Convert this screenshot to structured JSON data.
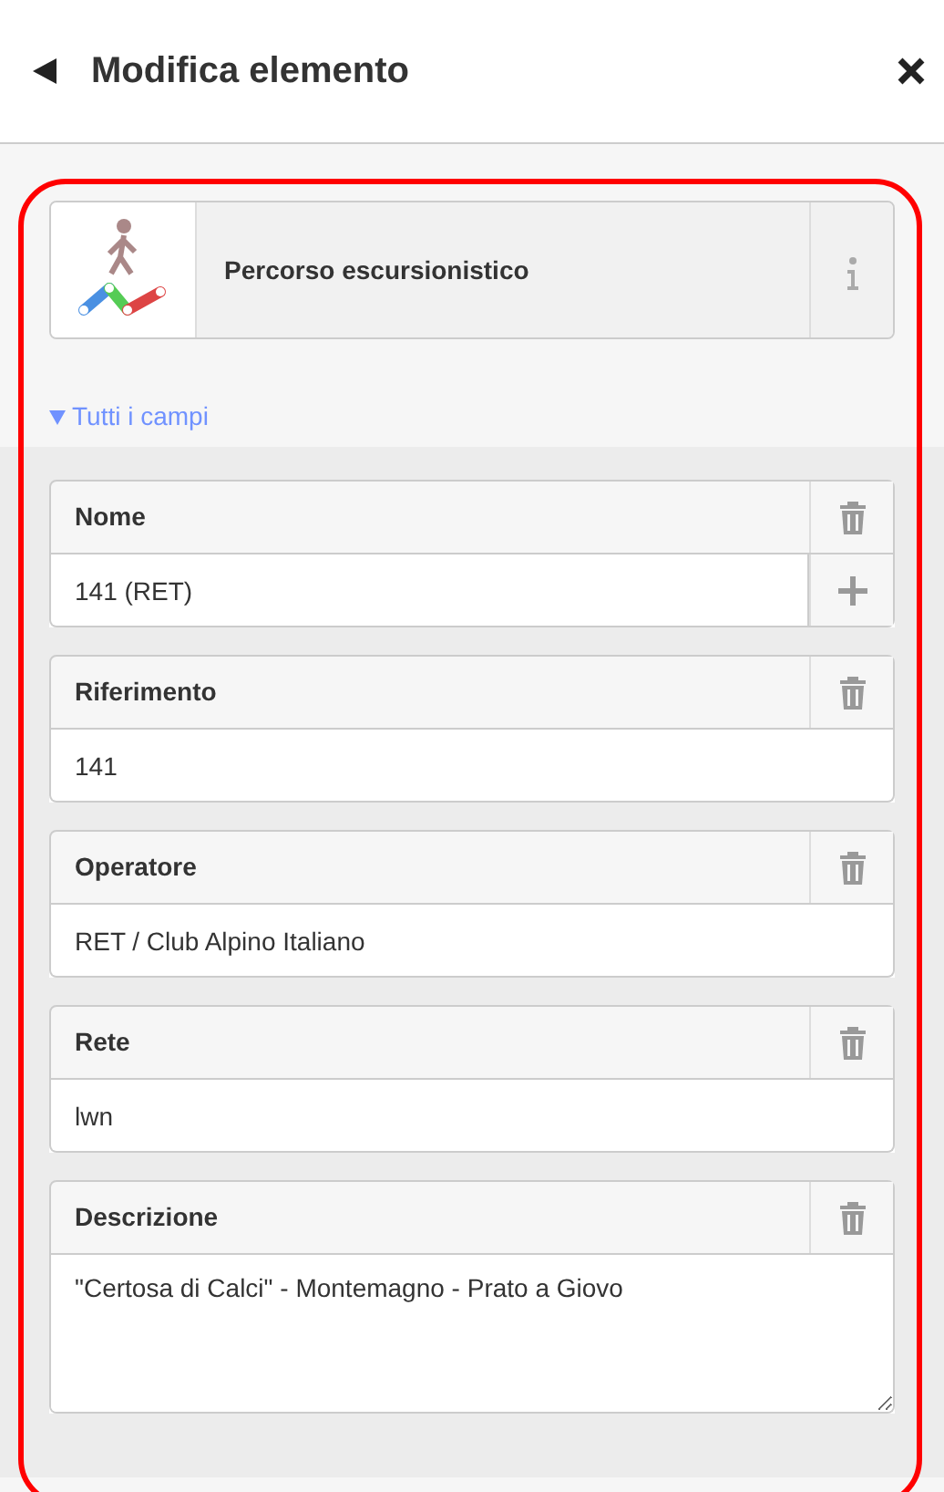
{
  "header": {
    "title": "Modifica elemento"
  },
  "preset": {
    "name": "Percorso escursionistico"
  },
  "section": {
    "label": "Tutti i campi",
    "expanded": true
  },
  "fields": [
    {
      "kind": "text",
      "label": "Nome",
      "value": "141 (RET)",
      "addable": true
    },
    {
      "kind": "text",
      "label": "Riferimento",
      "value": "141",
      "addable": false
    },
    {
      "kind": "text",
      "label": "Operatore",
      "value": "RET / Club Alpino Italiano",
      "addable": false
    },
    {
      "kind": "text",
      "label": "Rete",
      "value": "lwn",
      "addable": false
    },
    {
      "kind": "textarea",
      "label": "Descrizione",
      "value": "\"Certosa di Calci\" - Montemagno - Prato a Giovo"
    }
  ],
  "highlighted": true
}
